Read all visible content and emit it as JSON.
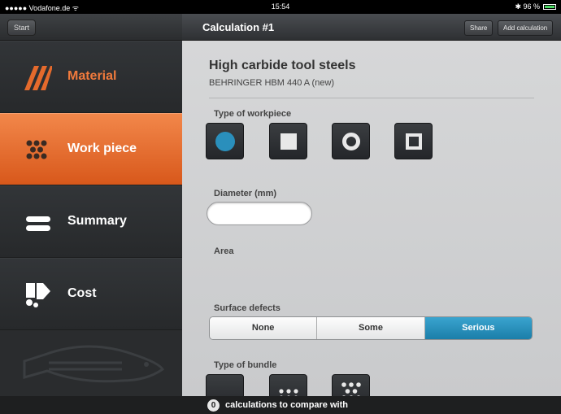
{
  "status_bar": {
    "carrier": "●●●●● Vodafone.de ᯤ",
    "time": "15:54",
    "battery": "✱ 96 %"
  },
  "sidebar": {
    "start_label": "Start",
    "items": [
      {
        "label": "Material",
        "icon": "stripes-icon",
        "active": false
      },
      {
        "label": "Work piece",
        "icon": "dots-icon",
        "active": true
      },
      {
        "label": "Summary",
        "icon": "bars-icon",
        "active": false
      },
      {
        "label": "Cost",
        "icon": "cost-icon",
        "active": false
      }
    ],
    "logo": "fish-logo"
  },
  "header": {
    "title": "Calculation #1",
    "share_label": "Share",
    "add_label": "Add calculation"
  },
  "main": {
    "material_title": "High carbide tool steels",
    "material_sub": "BEHRINGER HBM 440 A (new)",
    "type_workpiece_label": "Type of workpiece",
    "workpiece_types": [
      "round",
      "square",
      "tube",
      "square-tube"
    ],
    "selected_workpiece": "round",
    "diameter_label": "Diameter (mm)",
    "diameter_value": "",
    "area_label": "Area",
    "surface_label": "Surface defects",
    "surface_options": [
      "None",
      "Some",
      "Serious"
    ],
    "surface_selected": "Serious",
    "bundle_label": "Type of bundle"
  },
  "bottom_bar": {
    "count": "0",
    "text": "calculations to compare with"
  },
  "colors": {
    "accent_orange": "#e56a2c",
    "accent_blue": "#2a8fbc"
  }
}
